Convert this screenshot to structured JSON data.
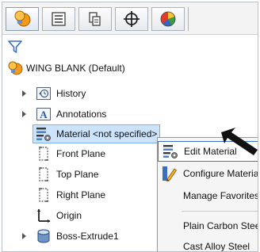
{
  "toolbar": {
    "tabs": [
      {
        "icon": "feature-manager-icon"
      },
      {
        "icon": "property-manager-icon"
      },
      {
        "icon": "configuration-manager-icon"
      },
      {
        "icon": "dimxpert-manager-icon"
      },
      {
        "icon": "display-manager-icon"
      }
    ]
  },
  "tree": {
    "filter_icon": "filter-icon",
    "root_label": "WING BLANK  (Default)",
    "items": [
      {
        "label": "History",
        "icon": "history-icon",
        "expandable": true
      },
      {
        "label": "Annotations",
        "icon": "annotations-icon",
        "expandable": true
      },
      {
        "label": "Material <not specified>",
        "icon": "material-icon",
        "expandable": false,
        "selected": true
      },
      {
        "label": "Front Plane",
        "icon": "plane-icon",
        "expandable": false
      },
      {
        "label": "Top Plane",
        "icon": "plane-icon",
        "expandable": false
      },
      {
        "label": "Right Plane",
        "icon": "plane-icon",
        "expandable": false
      },
      {
        "label": "Origin",
        "icon": "origin-icon",
        "expandable": false
      },
      {
        "label": "Boss-Extrude1",
        "icon": "boss-extrude-icon",
        "expandable": true
      }
    ]
  },
  "context_menu": {
    "items": [
      {
        "label": "Edit Material",
        "icon": "edit-material-icon",
        "highlighted": true
      },
      {
        "label": "Configure Materia",
        "icon": "configure-material-icon"
      },
      {
        "label": "Manage Favorites",
        "icon": ""
      },
      {
        "label": "Plain Carbon Steel",
        "icon": ""
      },
      {
        "label": "Cast Alloy Steel",
        "icon": ""
      }
    ]
  },
  "colors": {
    "selection": "#cbe3fb",
    "menu_highlight_border": "#3c73c6",
    "tree_icon_orange": "#f0a020"
  }
}
